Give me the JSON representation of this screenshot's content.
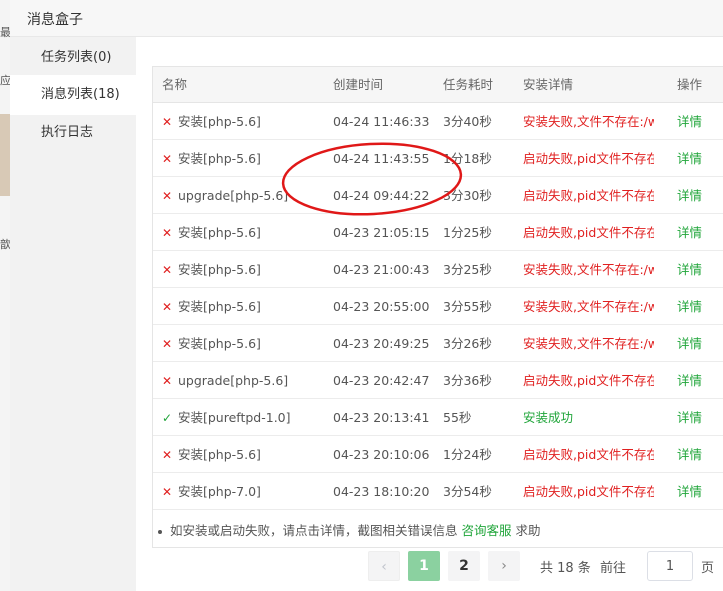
{
  "dialog": {
    "title": "消息盒子"
  },
  "sidebar": {
    "items": [
      {
        "label": "任务列表(0)"
      },
      {
        "label": "消息列表(18)"
      },
      {
        "label": "执行日志"
      }
    ]
  },
  "table": {
    "headers": {
      "name": "名称",
      "time": "创建时间",
      "duration": "任务耗时",
      "detail": "安装详情",
      "op": "操作"
    },
    "rows": [
      {
        "status": "fail",
        "icon": "✕",
        "name": "安装[php-5.6]",
        "time": "04-24 11:46:33",
        "duration": "3分40秒",
        "detail": "安装失败,文件不存在:/w",
        "op": "详情"
      },
      {
        "status": "fail",
        "icon": "✕",
        "name": "安装[php-5.6]",
        "time": "04-24 11:43:55",
        "duration": "1分18秒",
        "detail": "启动失败,pid文件不存在",
        "op": "详情"
      },
      {
        "status": "fail",
        "icon": "✕",
        "name": "upgrade[php-5.6]",
        "time": "04-24 09:44:22",
        "duration": "3分30秒",
        "detail": "启动失败,pid文件不存在",
        "op": "详情"
      },
      {
        "status": "fail",
        "icon": "✕",
        "name": "安装[php-5.6]",
        "time": "04-23 21:05:15",
        "duration": "1分25秒",
        "detail": "启动失败,pid文件不存在",
        "op": "详情"
      },
      {
        "status": "fail",
        "icon": "✕",
        "name": "安装[php-5.6]",
        "time": "04-23 21:00:43",
        "duration": "3分25秒",
        "detail": "安装失败,文件不存在:/w",
        "op": "详情"
      },
      {
        "status": "fail",
        "icon": "✕",
        "name": "安装[php-5.6]",
        "time": "04-23 20:55:00",
        "duration": "3分55秒",
        "detail": "安装失败,文件不存在:/w",
        "op": "详情"
      },
      {
        "status": "fail",
        "icon": "✕",
        "name": "安装[php-5.6]",
        "time": "04-23 20:49:25",
        "duration": "3分26秒",
        "detail": "安装失败,文件不存在:/w",
        "op": "详情"
      },
      {
        "status": "fail",
        "icon": "✕",
        "name": "upgrade[php-5.6]",
        "time": "04-23 20:42:47",
        "duration": "3分36秒",
        "detail": "启动失败,pid文件不存在",
        "op": "详情"
      },
      {
        "status": "ok",
        "icon": "✓",
        "name": "安装[pureftpd-1.0]",
        "time": "04-23 20:13:41",
        "duration": "55秒",
        "detail": "安装成功",
        "op": "详情"
      },
      {
        "status": "fail",
        "icon": "✕",
        "name": "安装[php-5.6]",
        "time": "04-23 20:10:06",
        "duration": "1分24秒",
        "detail": "启动失败,pid文件不存在",
        "op": "详情"
      },
      {
        "status": "fail",
        "icon": "✕",
        "name": "安装[php-7.0]",
        "time": "04-23 18:10:20",
        "duration": "3分54秒",
        "detail": "启动失败,pid文件不存在",
        "op": "详情"
      }
    ]
  },
  "tip": {
    "text": "如安装或启动失败，请点击详情，截图相关错误信息",
    "link": "咨询客服",
    "suffix": "求助"
  },
  "pagination": {
    "prev": "‹",
    "pages": [
      "1",
      "2"
    ],
    "next": "›",
    "total": "共 18 条",
    "goto": "前往",
    "current": "1",
    "unit": "页"
  },
  "background_glyphs": [
    "最",
    "应",
    "歆"
  ],
  "colors": {
    "success": "#20a53a",
    "error": "#e02020",
    "annotation": "#e01818"
  },
  "icons": {
    "fail": "close-icon",
    "ok": "check-icon",
    "prev": "chevron-left-icon",
    "next": "chevron-right-icon"
  }
}
